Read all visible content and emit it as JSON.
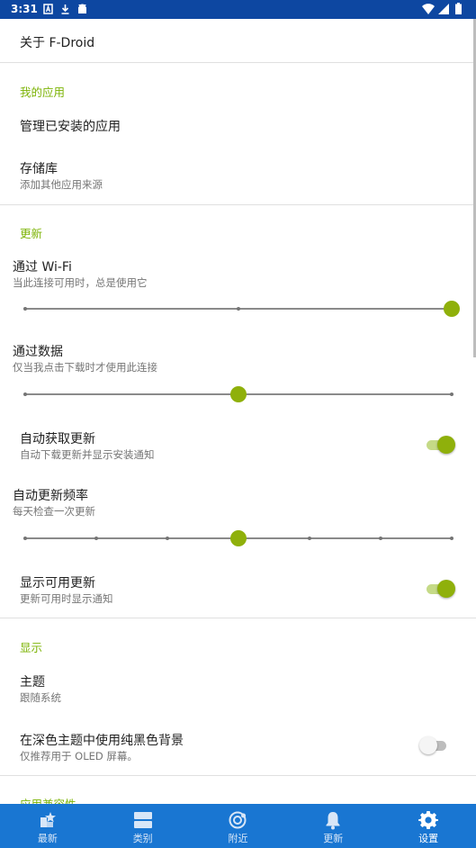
{
  "status_bar": {
    "time": "3:31",
    "icons_left": [
      "notification-a-icon",
      "download-icon",
      "android-icon"
    ],
    "icons_right": [
      "wifi-icon",
      "signal-icon",
      "battery-icon"
    ]
  },
  "about": {
    "title": "关于 F-Droid"
  },
  "my_apps": {
    "header": "我的应用",
    "manage_installed": {
      "title": "管理已安装的应用"
    },
    "repositories": {
      "title": "存储库",
      "summary": "添加其他应用来源"
    }
  },
  "updates": {
    "header": "更新",
    "over_wifi": {
      "title": "通过 Wi-Fi",
      "summary": "当此连接可用时，总是使用它",
      "level_fraction": 1.0,
      "steps": 3
    },
    "over_data": {
      "title": "通过数据",
      "summary": "仅当我点击下载时才使用此连接",
      "level_fraction": 0.5,
      "steps": 3
    },
    "auto_fetch": {
      "title": "自动获取更新",
      "summary": "自动下载更新并显示安装通知",
      "enabled": true
    },
    "frequency": {
      "title": "自动更新频率",
      "summary": "每天检查一次更新",
      "level_fraction": 0.5,
      "steps": 7
    },
    "show_available": {
      "title": "显示可用更新",
      "summary": "更新可用时显示通知",
      "enabled": true
    }
  },
  "display": {
    "header": "显示",
    "theme": {
      "title": "主题",
      "summary": "跟随系统"
    },
    "pure_black": {
      "title": "在深色主题中使用纯黑色背景",
      "summary": "仅推荐用于 OLED 屏幕。",
      "enabled": false
    }
  },
  "compatibility": {
    "header": "应用兼容性"
  },
  "bottom_nav": {
    "items": [
      {
        "label": "最新",
        "icon": "whats-new-icon"
      },
      {
        "label": "类别",
        "icon": "categories-icon"
      },
      {
        "label": "附近",
        "icon": "nearby-icon"
      },
      {
        "label": "更新",
        "icon": "updates-bell-icon"
      },
      {
        "label": "设置",
        "icon": "settings-gear-icon",
        "active": true
      }
    ]
  },
  "colors": {
    "status_bar": "#0d47a1",
    "accent": "#8fb00b",
    "section_header": "#7cb305",
    "bottom_nav": "#1976d2"
  }
}
